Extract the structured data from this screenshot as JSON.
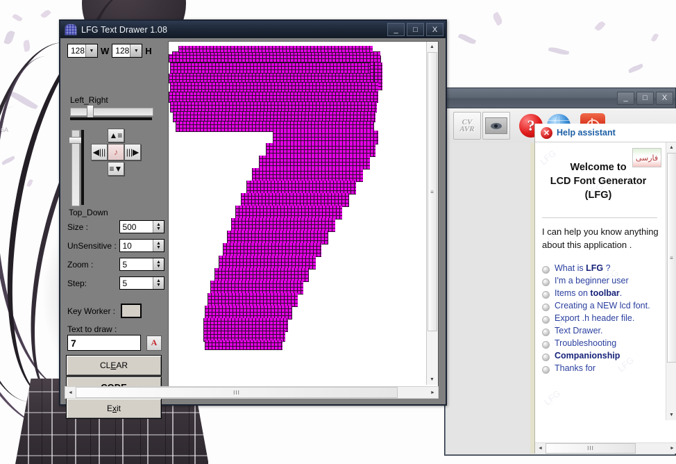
{
  "desktop": {
    "corner_text": "6A"
  },
  "lfg_window": {
    "title": "LFG Text Drawer 1.08",
    "icon": "app-icon",
    "buttons": {
      "minimize": "_",
      "maximize": "□",
      "close": "X"
    },
    "dimensions": {
      "width_value": "128",
      "width_label": "W",
      "height_value": "128",
      "height_label": "H"
    },
    "sliders": {
      "left_right_label": "Left_Right",
      "top_down_label": "Top_Down"
    },
    "dpad": {
      "up": "up-arrow",
      "down": "down-arrow",
      "left": "left-arrow",
      "right": "right-arrow",
      "center": "reset-icon"
    },
    "fields": [
      {
        "label": "Size :",
        "value": "500"
      },
      {
        "label": "UnSensitive :",
        "value": "10"
      },
      {
        "label": "Zoom :",
        "value": "5"
      },
      {
        "label": "Step:",
        "value": "5"
      }
    ],
    "key_worker": {
      "label": "Key Worker :",
      "color": "#d4d0c8"
    },
    "text_to_draw": {
      "label": "Text to draw :",
      "value": "7"
    },
    "actions": [
      {
        "label": "CLEAR",
        "accel": "E",
        "bold": false
      },
      {
        "label": "CODE",
        "accel": "C",
        "bold": true
      },
      {
        "label": "Exit",
        "accel": "x",
        "bold": false
      }
    ],
    "canvas": {
      "glyph": "7",
      "pixel_color": "#e300e3",
      "grid_color": "#2b0b2b"
    }
  },
  "bg_window": {
    "buttons": {
      "minimize": "_",
      "maximize": "□",
      "close": "X"
    },
    "toolbar": [
      {
        "name": "cvavr-button",
        "line1": "CV",
        "line2": "AVR"
      },
      {
        "name": "preview-eye-button",
        "label": ""
      },
      {
        "name": "help-button",
        "label": "?"
      },
      {
        "name": "globe-button",
        "label": ""
      },
      {
        "name": "exit-power-button",
        "label": ""
      }
    ]
  },
  "help": {
    "header_title": "Help assistant",
    "close_icon": "✕",
    "language_button": "فارسی",
    "welcome_lines": [
      "Welcome to",
      "LCD Font Generator",
      "(LFG)"
    ],
    "intro": "I can help you know anything about this application .",
    "links": [
      {
        "text": "What is LFG ?",
        "bold_word": "LFG",
        "bold": false
      },
      {
        "text": "I'm a beginner user",
        "bold_word": "",
        "bold": false
      },
      {
        "text": "Items on toolbar.",
        "bold_word": "toolbar",
        "bold": false
      },
      {
        "text": "Creating a NEW lcd font.",
        "bold_word": "",
        "bold": false
      },
      {
        "text": "Export .h header file.",
        "bold_word": "",
        "bold": false
      },
      {
        "text": "Text Drawer.",
        "bold_word": "",
        "bold": false
      },
      {
        "text": "Troubleshooting",
        "bold_word": "",
        "bold": false
      },
      {
        "text": "Companionship",
        "bold_word": "",
        "bold": true
      },
      {
        "text": "Thanks for",
        "bold_word": "",
        "bold": false
      }
    ],
    "watermark": "LFG"
  },
  "scroll": {
    "grip": "≡",
    "up": "▲",
    "down": "▼",
    "left": "◄",
    "right": "►",
    "hgrip": "III"
  }
}
